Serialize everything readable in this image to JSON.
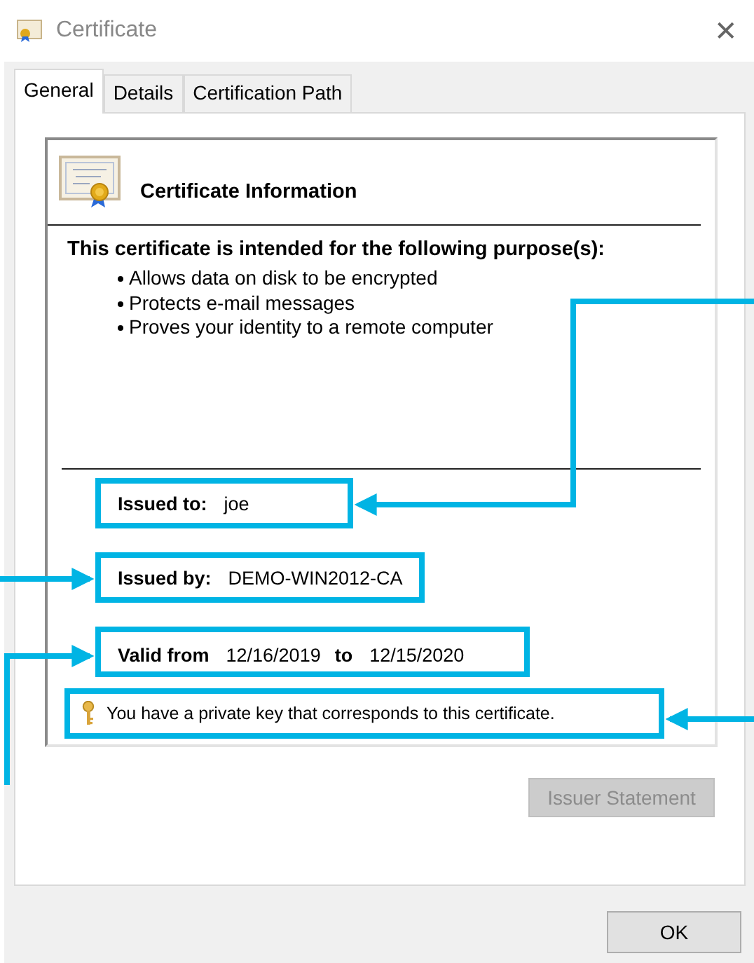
{
  "window": {
    "title": "Certificate",
    "close": "✕"
  },
  "tabs": [
    {
      "label": "General",
      "selected": true
    },
    {
      "label": "Details",
      "selected": false
    },
    {
      "label": "Certification Path",
      "selected": false
    }
  ],
  "header": {
    "title": "Certificate Information"
  },
  "purpose": {
    "heading": "This certificate is intended for the following purpose(s):",
    "items": [
      "Allows data on disk to be encrypted",
      "Protects e-mail messages",
      "Proves your identity to a remote computer"
    ]
  },
  "fields": [
    {
      "kind": "pair",
      "label": "Issued to:",
      "value": "joe",
      "highlighted": true
    },
    {
      "kind": "pair",
      "label": "Issued by:",
      "value": "DEMO-WIN2012-CA",
      "highlighted": true
    },
    {
      "kind": "range",
      "label": "Valid from",
      "value": "12/16/2019",
      "to_label": "to",
      "to_value": "12/15/2020",
      "highlighted": true
    },
    {
      "kind": "note",
      "value": "You have a private key that corresponds to this certificate.",
      "highlighted": true
    }
  ],
  "issuer_button": {
    "label": "Issuer Statement",
    "disabled": true
  },
  "ok_button": {
    "label": "OK",
    "disabled": false
  }
}
